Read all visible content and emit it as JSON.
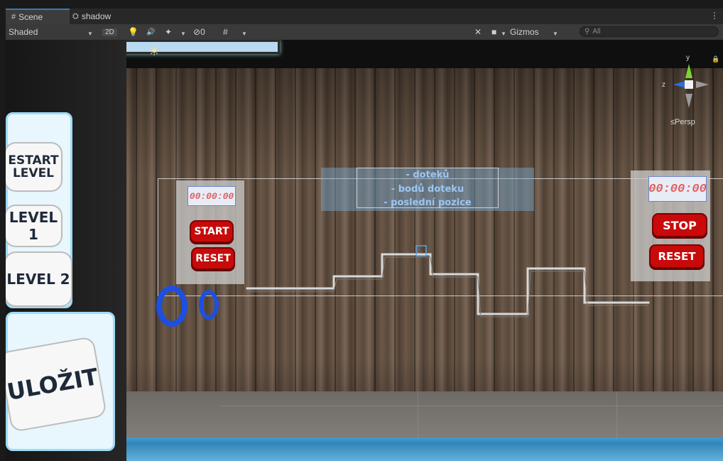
{
  "tabs": [
    {
      "icon": "#",
      "label": "Scene"
    },
    {
      "icon": "⛭",
      "label": "shadow"
    }
  ],
  "toolbar": {
    "shading_mode": "Shaded",
    "mode_2d": "2D",
    "hidden_count": "0",
    "gizmos_label": "Gizmos",
    "search_placeholder": "All"
  },
  "scene": {
    "left_menu": [
      {
        "label": "RESTART LEVEL",
        "line1": "ESTART",
        "line2": "LEVEL"
      },
      {
        "label": "LEVEL 1"
      },
      {
        "label": "LEVEL 2"
      },
      {
        "label": "ULOŽIT"
      }
    ],
    "left_timer": {
      "time": "00:00:00",
      "start_label": "START",
      "reset_label": "RESET"
    },
    "right_timer": {
      "time": "00:00:00",
      "stop_label": "STOP",
      "reset_label": "RESET"
    },
    "info_lines": [
      "- doteků",
      "- bodů doteku",
      "- poslední pozice"
    ]
  },
  "gizmo": {
    "y_label": "y",
    "z_label": "z",
    "projection_label": "Persp"
  }
}
